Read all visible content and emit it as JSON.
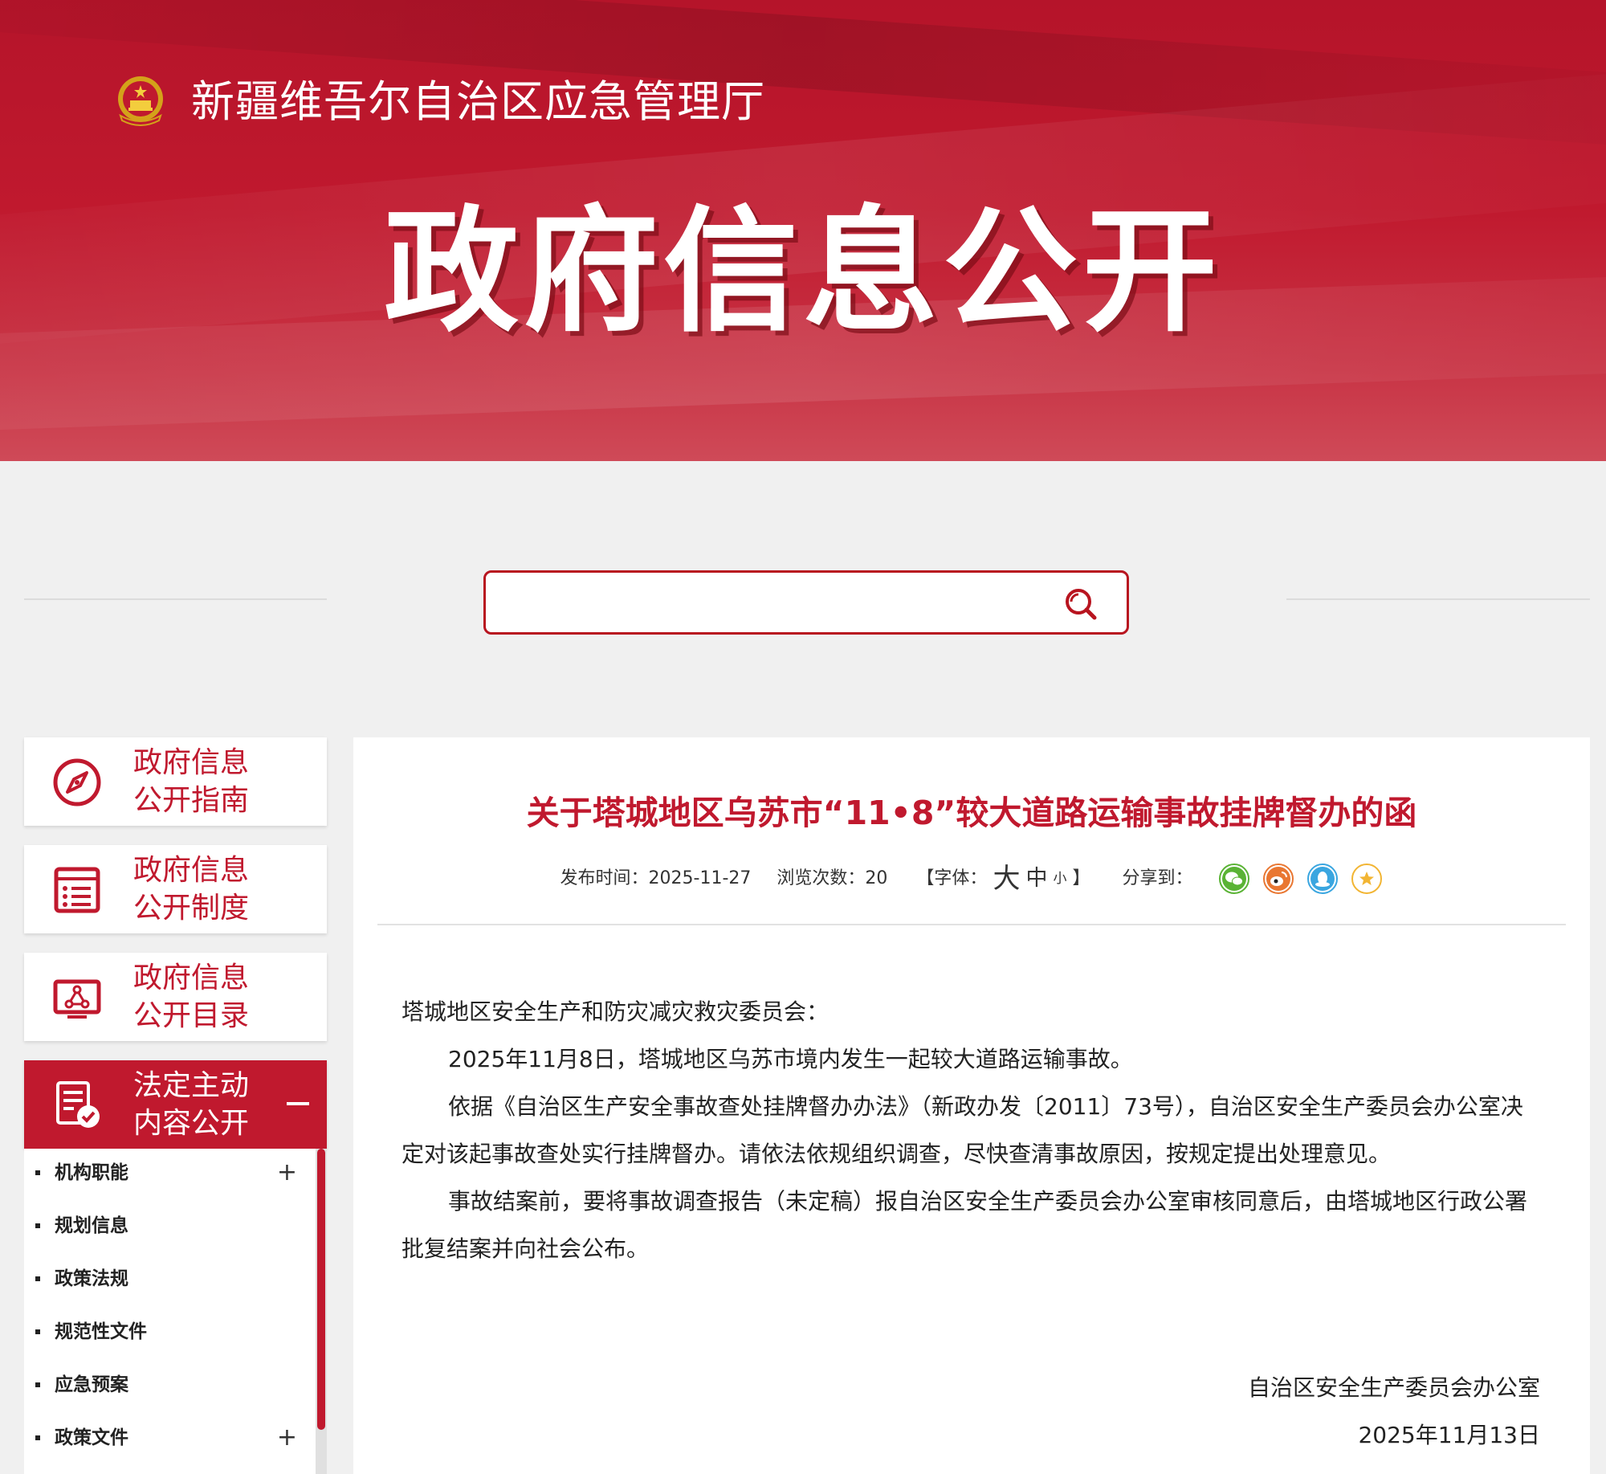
{
  "header": {
    "site_name": "新疆维吾尔自治区应急管理厅",
    "banner_title": "政府信息公开"
  },
  "search": {
    "placeholder": "",
    "value": ""
  },
  "sidebar": {
    "cards": [
      {
        "line1": "政府信息",
        "line2": "公开指南",
        "icon": "compass-icon"
      },
      {
        "line1": "政府信息",
        "line2": "公开制度",
        "icon": "document-list-icon"
      },
      {
        "line1": "政府信息",
        "line2": "公开目录",
        "icon": "monitor-network-icon"
      },
      {
        "line1": "法定主动",
        "line2": "内容公开",
        "icon": "document-check-icon",
        "active": true
      }
    ],
    "subitems": [
      {
        "label": "机构职能",
        "expand": "+"
      },
      {
        "label": "规划信息",
        "expand": ""
      },
      {
        "label": "政策法规",
        "expand": ""
      },
      {
        "label": "规范性文件",
        "expand": ""
      },
      {
        "label": "应急预案",
        "expand": ""
      },
      {
        "label": "政策文件",
        "expand": "+"
      }
    ]
  },
  "article": {
    "title": "关于塔城地区乌苏市“11•8”较大道路运输事故挂牌督办的函",
    "meta": {
      "publish_label": "发布时间：",
      "publish_date": "2025-11-27",
      "views_label": "浏览次数：",
      "views": "20",
      "font_open": "【字体：",
      "font_large": "大",
      "font_medium": "中",
      "font_small": "小",
      "font_close": "】",
      "share_label": "分享到："
    },
    "share_icons": [
      "wechat-icon",
      "weibo-icon",
      "qq-icon",
      "qzone-icon"
    ],
    "salutation": "塔城地区安全生产和防灾减灾救灾委员会：",
    "paragraphs": [
      "2025年11月8日，塔城地区乌苏市境内发生一起较大道路运输事故。",
      "依据《自治区生产安全事故查处挂牌督办办法》（新政办发〔2011〕73号），自治区安全生产委员会办公室决定对该起事故查处实行挂牌督办。请依法依规组织调查，尽快查清事故原因，按规定提出处理意见。",
      "事故结案前，要将事故调查报告（未定稿）报自治区安全生产委员会办公室审核同意后，由塔城地区行政公署批复结案并向社会公布。"
    ],
    "signature_org": "自治区安全生产委员会办公室",
    "signature_date": "2025年11月13日"
  },
  "colors": {
    "brand_red": "#c0192e",
    "banner_red": "#b5142a",
    "page_bg": "#f0f0f0"
  }
}
